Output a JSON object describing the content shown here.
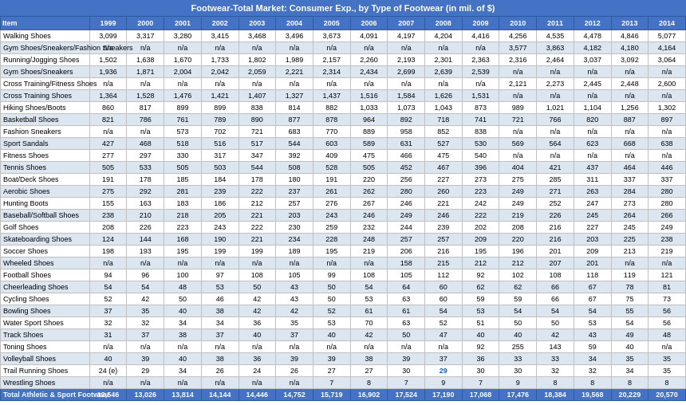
{
  "title": "Footwear-Total Market: Consumer Exp., by Type of Footwear (in mil. of $)",
  "headers": [
    "Item",
    "1999",
    "2000",
    "2001",
    "2002",
    "2003",
    "2004",
    "2005",
    "2006",
    "2007",
    "2008",
    "2009",
    "2010",
    "2011",
    "2012",
    "2013",
    "2014"
  ],
  "rows": [
    [
      "Walking Shoes",
      "3,099",
      "3,317",
      "3,280",
      "3,415",
      "3,468",
      "3,496",
      "3,673",
      "4,091",
      "4,197",
      "4,204",
      "4,416",
      "4,256",
      "4,535",
      "4,478",
      "4,846",
      "5,077"
    ],
    [
      "Gym Shoes/Sneakers/Fashion Sneakers",
      "n/a",
      "n/a",
      "n/a",
      "n/a",
      "n/a",
      "n/a",
      "n/a",
      "n/a",
      "n/a",
      "n/a",
      "n/a",
      "3,577",
      "3,863",
      "4,182",
      "4,180",
      "4,164"
    ],
    [
      "Running/Jogging Shoes",
      "1,502",
      "1,638",
      "1,670",
      "1,733",
      "1,802",
      "1,989",
      "2,157",
      "2,260",
      "2,193",
      "2,301",
      "2,363",
      "2,316",
      "2,464",
      "3,037",
      "3,092",
      "3,064"
    ],
    [
      "Gym Shoes/Sneakers",
      "1,936",
      "1,871",
      "2,004",
      "2,042",
      "2,059",
      "2,221",
      "2,314",
      "2,434",
      "2,699",
      "2,639",
      "2,539",
      "n/a",
      "n/a",
      "n/a",
      "n/a",
      "n/a"
    ],
    [
      "Cross Training/Fitness Shoes",
      "n/a",
      "n/a",
      "n/a",
      "n/a",
      "n/a",
      "n/a",
      "n/a",
      "n/a",
      "n/a",
      "n/a",
      "n/a",
      "2,121",
      "2,273",
      "2,445",
      "2,448",
      "2,600"
    ],
    [
      "Cross Training Shoes",
      "1,364",
      "1,528",
      "1,476",
      "1,421",
      "1,407",
      "1,327",
      "1,437",
      "1,516",
      "1,584",
      "1,626",
      "1,531",
      "n/a",
      "n/a",
      "n/a",
      "n/a",
      "n/a"
    ],
    [
      "Hiking Shoes/Boots",
      "860",
      "817",
      "899",
      "899",
      "838",
      "814",
      "882",
      "1,033",
      "1,073",
      "1,043",
      "873",
      "989",
      "1,021",
      "1,104",
      "1,256",
      "1,302"
    ],
    [
      "Basketball Shoes",
      "821",
      "786",
      "761",
      "789",
      "890",
      "877",
      "878",
      "964",
      "892",
      "718",
      "741",
      "721",
      "766",
      "820",
      "887",
      "897"
    ],
    [
      "Fashion Sneakers",
      "n/a",
      "n/a",
      "573",
      "702",
      "721",
      "683",
      "770",
      "889",
      "958",
      "852",
      "838",
      "n/a",
      "n/a",
      "n/a",
      "n/a",
      "n/a"
    ],
    [
      "Sport Sandals",
      "427",
      "468",
      "518",
      "516",
      "517",
      "544",
      "603",
      "589",
      "631",
      "527",
      "530",
      "569",
      "564",
      "623",
      "668",
      "638"
    ],
    [
      "Fitness Shoes",
      "277",
      "297",
      "330",
      "317",
      "347",
      "392",
      "409",
      "475",
      "466",
      "475",
      "540",
      "n/a",
      "n/a",
      "n/a",
      "n/a",
      "n/a"
    ],
    [
      "Tennis Shoes",
      "505",
      "533",
      "505",
      "503",
      "544",
      "508",
      "528",
      "505",
      "452",
      "467",
      "396",
      "404",
      "421",
      "437",
      "464",
      "446"
    ],
    [
      "Boat/Deck Shoes",
      "191",
      "178",
      "185",
      "184",
      "178",
      "180",
      "191",
      "220",
      "256",
      "227",
      "273",
      "275",
      "285",
      "311",
      "337",
      "337"
    ],
    [
      "Aerobic Shoes",
      "275",
      "292",
      "281",
      "239",
      "222",
      "237",
      "261",
      "262",
      "280",
      "260",
      "223",
      "249",
      "271",
      "263",
      "284",
      "280"
    ],
    [
      "Hunting Boots",
      "155",
      "163",
      "183",
      "186",
      "212",
      "257",
      "276",
      "267",
      "246",
      "221",
      "242",
      "249",
      "252",
      "247",
      "273",
      "280"
    ],
    [
      "Baseball/Softball Shoes",
      "238",
      "210",
      "218",
      "205",
      "221",
      "203",
      "243",
      "246",
      "249",
      "246",
      "222",
      "219",
      "226",
      "245",
      "264",
      "266"
    ],
    [
      "Golf Shoes",
      "208",
      "226",
      "223",
      "243",
      "222",
      "230",
      "259",
      "232",
      "244",
      "239",
      "202",
      "208",
      "216",
      "227",
      "245",
      "249"
    ],
    [
      "Skateboarding Shoes",
      "124",
      "144",
      "168",
      "190",
      "221",
      "234",
      "228",
      "248",
      "257",
      "257",
      "209",
      "220",
      "216",
      "203",
      "225",
      "238"
    ],
    [
      "Soccer Shoes",
      "198",
      "193",
      "195",
      "199",
      "199",
      "189",
      "195",
      "219",
      "206",
      "216",
      "195",
      "196",
      "201",
      "209",
      "213",
      "219"
    ],
    [
      "Wheeled Shoes",
      "n/a",
      "n/a",
      "n/a",
      "n/a",
      "n/a",
      "n/a",
      "n/a",
      "n/a",
      "158",
      "215",
      "212",
      "212",
      "207",
      "201",
      "n/a",
      "n/a"
    ],
    [
      "Football Shoes",
      "94",
      "96",
      "100",
      "97",
      "108",
      "105",
      "99",
      "108",
      "105",
      "112",
      "92",
      "102",
      "108",
      "118",
      "119",
      "121"
    ],
    [
      "Cheerleading Shoes",
      "54",
      "54",
      "48",
      "53",
      "50",
      "43",
      "50",
      "54",
      "64",
      "60",
      "62",
      "62",
      "66",
      "67",
      "78",
      "81"
    ],
    [
      "Cycling Shoes",
      "52",
      "42",
      "50",
      "46",
      "42",
      "43",
      "50",
      "53",
      "63",
      "60",
      "59",
      "59",
      "66",
      "67",
      "75",
      "73"
    ],
    [
      "Bowling Shoes",
      "37",
      "35",
      "40",
      "38",
      "42",
      "42",
      "52",
      "61",
      "61",
      "54",
      "53",
      "54",
      "54",
      "54",
      "55",
      "56"
    ],
    [
      "Water Sport Shoes",
      "32",
      "32",
      "34",
      "34",
      "36",
      "35",
      "53",
      "70",
      "63",
      "52",
      "51",
      "50",
      "50",
      "53",
      "54",
      "56"
    ],
    [
      "Track Shoes",
      "31",
      "37",
      "38",
      "37",
      "40",
      "37",
      "40",
      "42",
      "50",
      "47",
      "40",
      "40",
      "42",
      "43",
      "49",
      "48"
    ],
    [
      "Toning Shoes",
      "n/a",
      "n/a",
      "n/a",
      "n/a",
      "n/a",
      "n/a",
      "n/a",
      "n/a",
      "n/a",
      "n/a",
      "92",
      "255",
      "143",
      "59",
      "40",
      "n/a"
    ],
    [
      "Volleyball Shoes",
      "40",
      "39",
      "40",
      "38",
      "36",
      "39",
      "39",
      "38",
      "39",
      "37",
      "36",
      "33",
      "33",
      "34",
      "35",
      "35"
    ],
    [
      "Trail Running Shoes",
      "24 (e)",
      "29",
      "34",
      "26",
      "24",
      "26",
      "27",
      "27",
      "30",
      "29",
      "30",
      "30",
      "32",
      "32",
      "34",
      "35"
    ],
    [
      "Wrestling Shoes",
      "n/a",
      "n/a",
      "n/a",
      "n/a",
      "n/a",
      "n/a",
      "7",
      "8",
      "7",
      "9",
      "7",
      "9",
      "8",
      "8",
      "8",
      "8"
    ],
    [
      "Total Athletic & Sport Footwear",
      "12,546",
      "13,026",
      "13,814",
      "14,144",
      "14,446",
      "14,752",
      "15,719",
      "16,902",
      "17,524",
      "17,190",
      "17,068",
      "17,476",
      "18,384",
      "19,568",
      "20,229",
      "20,570"
    ]
  ],
  "highlight_rows": [
    9
  ],
  "special_cells": {
    "30_9": "30"
  }
}
